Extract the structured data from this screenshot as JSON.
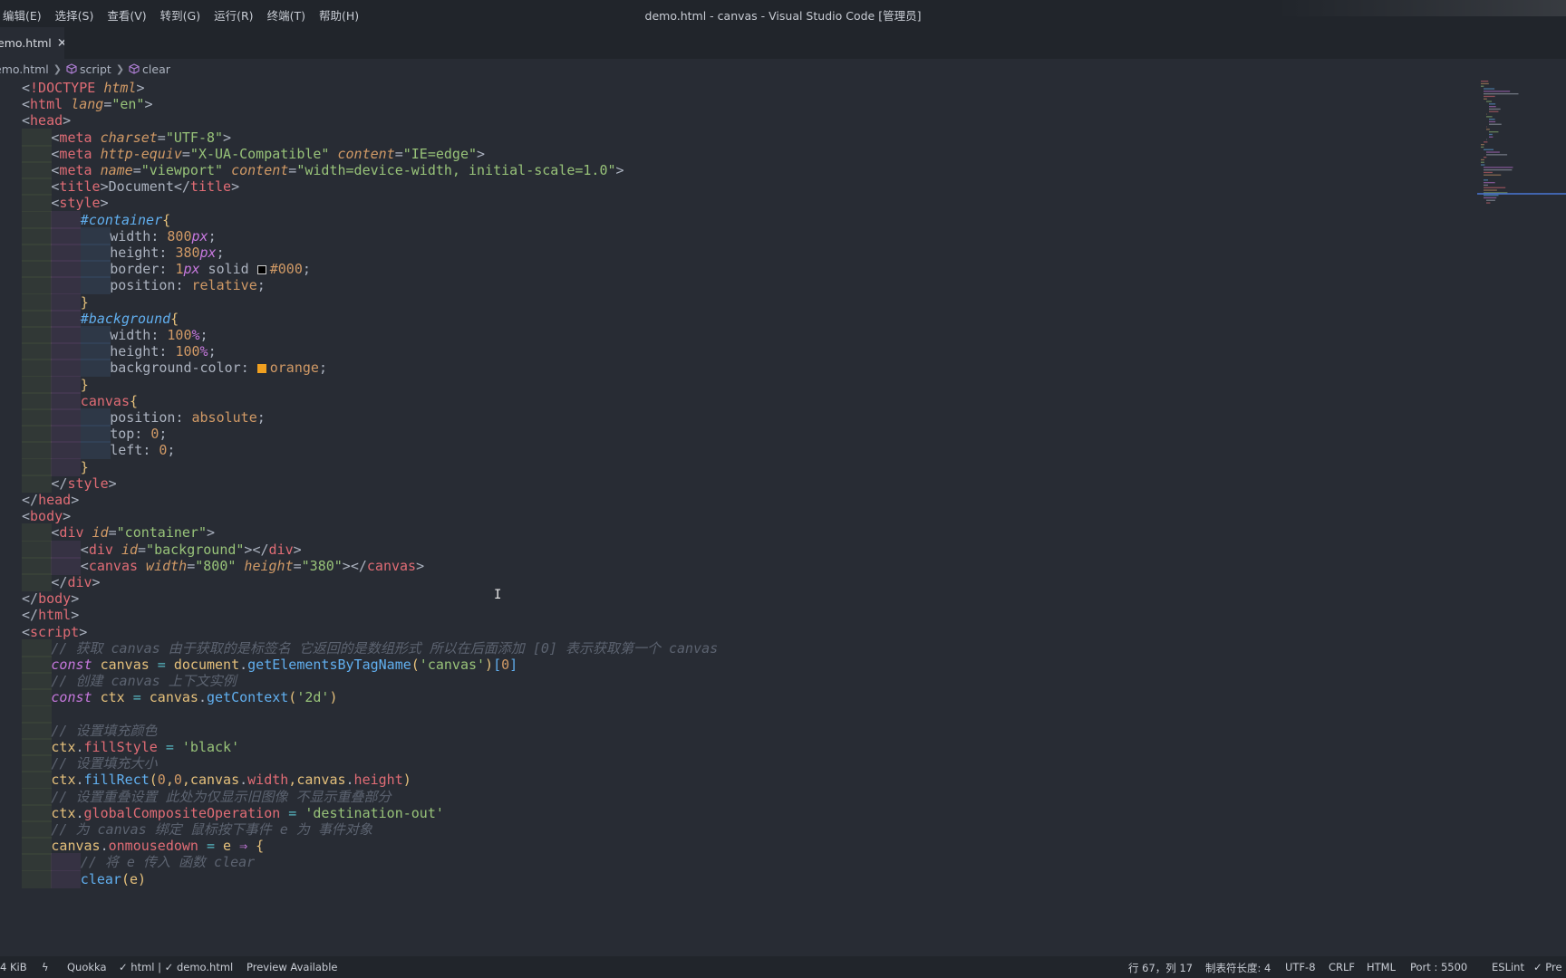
{
  "menu": [
    "编辑(E)",
    "选择(S)",
    "查看(V)",
    "转到(G)",
    "运行(R)",
    "终端(T)",
    "帮助(H)"
  ],
  "window_title": "demo.html - canvas - Visual Studio Code [管理员]",
  "tab": {
    "label": "emo.html",
    "close": "✕"
  },
  "breadcrumb": {
    "file": "emo.html",
    "item1": "script",
    "item2": "clear"
  },
  "code_lines": [
    [
      0,
      "<!DOCTYPE html>"
    ],
    [
      0,
      "<html lang=\"en\">"
    ],
    [
      0,
      "<head>"
    ],
    [
      1,
      "<meta charset=\"UTF-8\">"
    ],
    [
      1,
      "<meta http-equiv=\"X-UA-Compatible\" content=\"IE=edge\">"
    ],
    [
      1,
      "<meta name=\"viewport\" content=\"width=device-width, initial-scale=1.0\">"
    ],
    [
      1,
      "<title>Document</title>"
    ],
    [
      1,
      "<style>"
    ],
    [
      2,
      "#container{"
    ],
    [
      3,
      "width: 800px;"
    ],
    [
      3,
      "height: 380px;"
    ],
    [
      3,
      "border: 1px solid #000;"
    ],
    [
      3,
      "position: relative;"
    ],
    [
      2,
      "}"
    ],
    [
      2,
      "#background{"
    ],
    [
      3,
      "width: 100%;"
    ],
    [
      3,
      "height: 100%;"
    ],
    [
      3,
      "background-color: orange;"
    ],
    [
      2,
      "}"
    ],
    [
      2,
      "canvas{"
    ],
    [
      3,
      "position: absolute;"
    ],
    [
      3,
      "top: 0;"
    ],
    [
      3,
      "left: 0;"
    ],
    [
      2,
      "}"
    ],
    [
      1,
      "</style>"
    ],
    [
      0,
      "</head>"
    ],
    [
      0,
      "<body>"
    ],
    [
      1,
      "<div id=\"container\">"
    ],
    [
      2,
      "<div id=\"background\"></div>"
    ],
    [
      2,
      "<canvas width=\"800\" height=\"380\"></canvas>"
    ],
    [
      1,
      "</div>"
    ],
    [
      0,
      "</body>"
    ],
    [
      0,
      "</html>"
    ],
    [
      0,
      "<script>"
    ],
    [
      1,
      "// 获取 canvas 由于获取的是标签名 它返回的是数组形式 所以在后面添加 [0] 表示获取第一个 canvas"
    ],
    [
      1,
      "const canvas = document.getElementsByTagName('canvas')[0]"
    ],
    [
      1,
      "// 创建 canvas 上下文实例"
    ],
    [
      1,
      "const ctx = canvas.getContext('2d')"
    ],
    [
      1,
      ""
    ],
    [
      1,
      "// 设置填充颜色"
    ],
    [
      1,
      "ctx.fillStyle = 'black'"
    ],
    [
      1,
      "// 设置填充大小"
    ],
    [
      1,
      "ctx.fillRect(0,0,canvas.width,canvas.height)"
    ],
    [
      1,
      "// 设置重叠设置 此处为仅显示旧图像 不显示重叠部分"
    ],
    [
      1,
      "ctx.globalCompositeOperation = 'destination-out'"
    ],
    [
      1,
      "// 为 canvas 绑定 鼠标按下事件 e 为 事件对象"
    ],
    [
      1,
      "canvas.onmousedown = e ⇒ {"
    ],
    [
      2,
      "// 将 e 传入 函数 clear"
    ],
    [
      2,
      "clear(e)"
    ]
  ],
  "status": {
    "size": "4 KiB",
    "quokka": "Quokka",
    "html_check": "✓ html | ✓ demo.html",
    "preview": "Preview Available",
    "position": "行 67，列 17",
    "tab_size": "制表符长度: 4",
    "encoding": "UTF-8",
    "eol": "CRLF",
    "language": "HTML",
    "port": "Port : 5500",
    "eslint": "ESLint",
    "prettier": "✓ Pre"
  },
  "colors": {
    "editor_bg": "#282c34",
    "chrome_bg": "#21252b",
    "tag": "#e06c75",
    "attr": "#d19a66",
    "string": "#98c379",
    "keyword": "#c678dd",
    "function": "#61afef",
    "comment": "#5c6370"
  }
}
